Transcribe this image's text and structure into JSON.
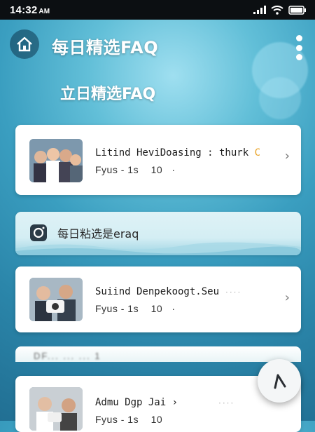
{
  "status_bar": {
    "time": "14:32",
    "ampm": "AM"
  },
  "header": {
    "title": "每日精选FAQ"
  },
  "section": {
    "title": "立日精选FAQ"
  },
  "cards": [
    {
      "title": "Litind HeviDoasing : thurk",
      "meta_label": "Fyus - 1s",
      "meta_count": "10",
      "meta_suffix": "·"
    },
    {
      "title": "Suiind Denpekoogt.Seu",
      "meta_label": "Fyus - 1s",
      "meta_count": "10",
      "meta_suffix": "·"
    },
    {
      "title": "Admu Dgp Jai",
      "meta_label": "Fyus - 1s",
      "meta_count": "10",
      "meta_suffix": ""
    }
  ],
  "banner": {
    "text": "每日粘选是eraq"
  },
  "ghost_row": {
    "text": "DF... ... ... 1"
  },
  "icons": {
    "home": "home-icon",
    "more": "more-vertical-icon",
    "chevron": "chevron-right-icon",
    "camera": "camera-icon",
    "fab": "navigation-arrow-icon"
  },
  "colors": {
    "accent": "#2b86aa",
    "card_bg": "#ffffff",
    "title_text": "#ffffff",
    "accent_orange": "#e8a020"
  }
}
